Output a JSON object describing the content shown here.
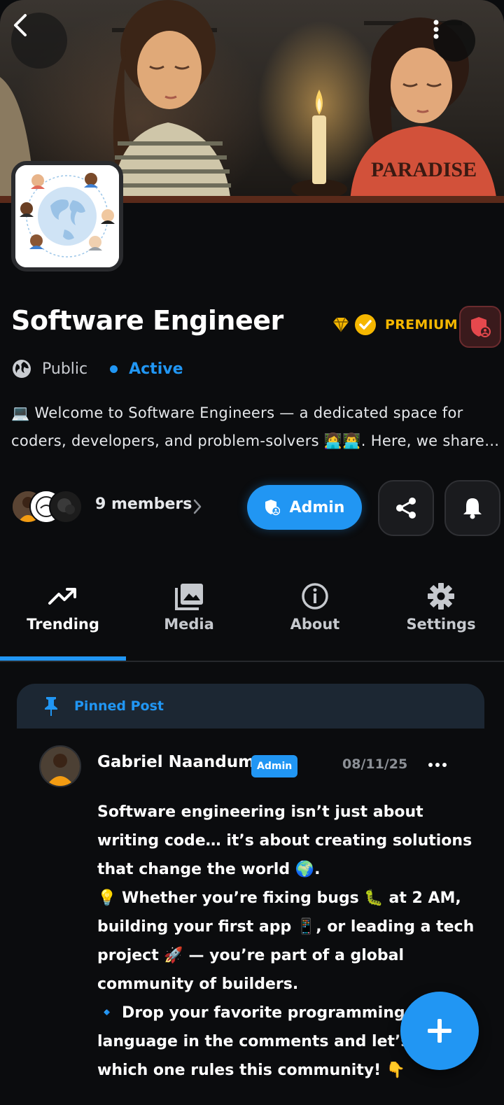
{
  "group": {
    "title": "Software Engineer",
    "premium_label": "PREMIUM",
    "privacy_label": "Public",
    "status_label": "Active",
    "description": "💻 Welcome to Software Engineers — a dedicated space for coders, developers, and problem-solvers 👩‍💻👨‍💻. Here, we share knowledge, ideas, and experiences.",
    "cover_shirt_text": "PARADISE"
  },
  "members": {
    "label": "9 members"
  },
  "actions": {
    "admin_label": "Admin"
  },
  "tabs": [
    {
      "label": "Trending",
      "icon": "trending-icon"
    },
    {
      "label": "Media",
      "icon": "media-icon"
    },
    {
      "label": "About",
      "icon": "info-icon"
    },
    {
      "label": "Settings",
      "icon": "gear-icon"
    }
  ],
  "pinned": {
    "label": "Pinned Post",
    "author": "Gabriel Naandum",
    "author_badge": "Admin",
    "date": "08/11/25",
    "body": [
      "Software engineering isn’t just about writing code… it’s about creating solutions that change the world 🌍.",
      "💡 Whether you’re fixing bugs 🐛 at 2 AM, building your first app 📱, or leading a tech project 🚀 — you’re part of a global community of builders.",
      "",
      "🔹 Drop your favorite programming language in the comments and let’s see which one rules this community! 👇"
    ]
  },
  "colors": {
    "accent": "#2196f3",
    "premium": "#f5b700",
    "background": "#0b0c0e"
  }
}
